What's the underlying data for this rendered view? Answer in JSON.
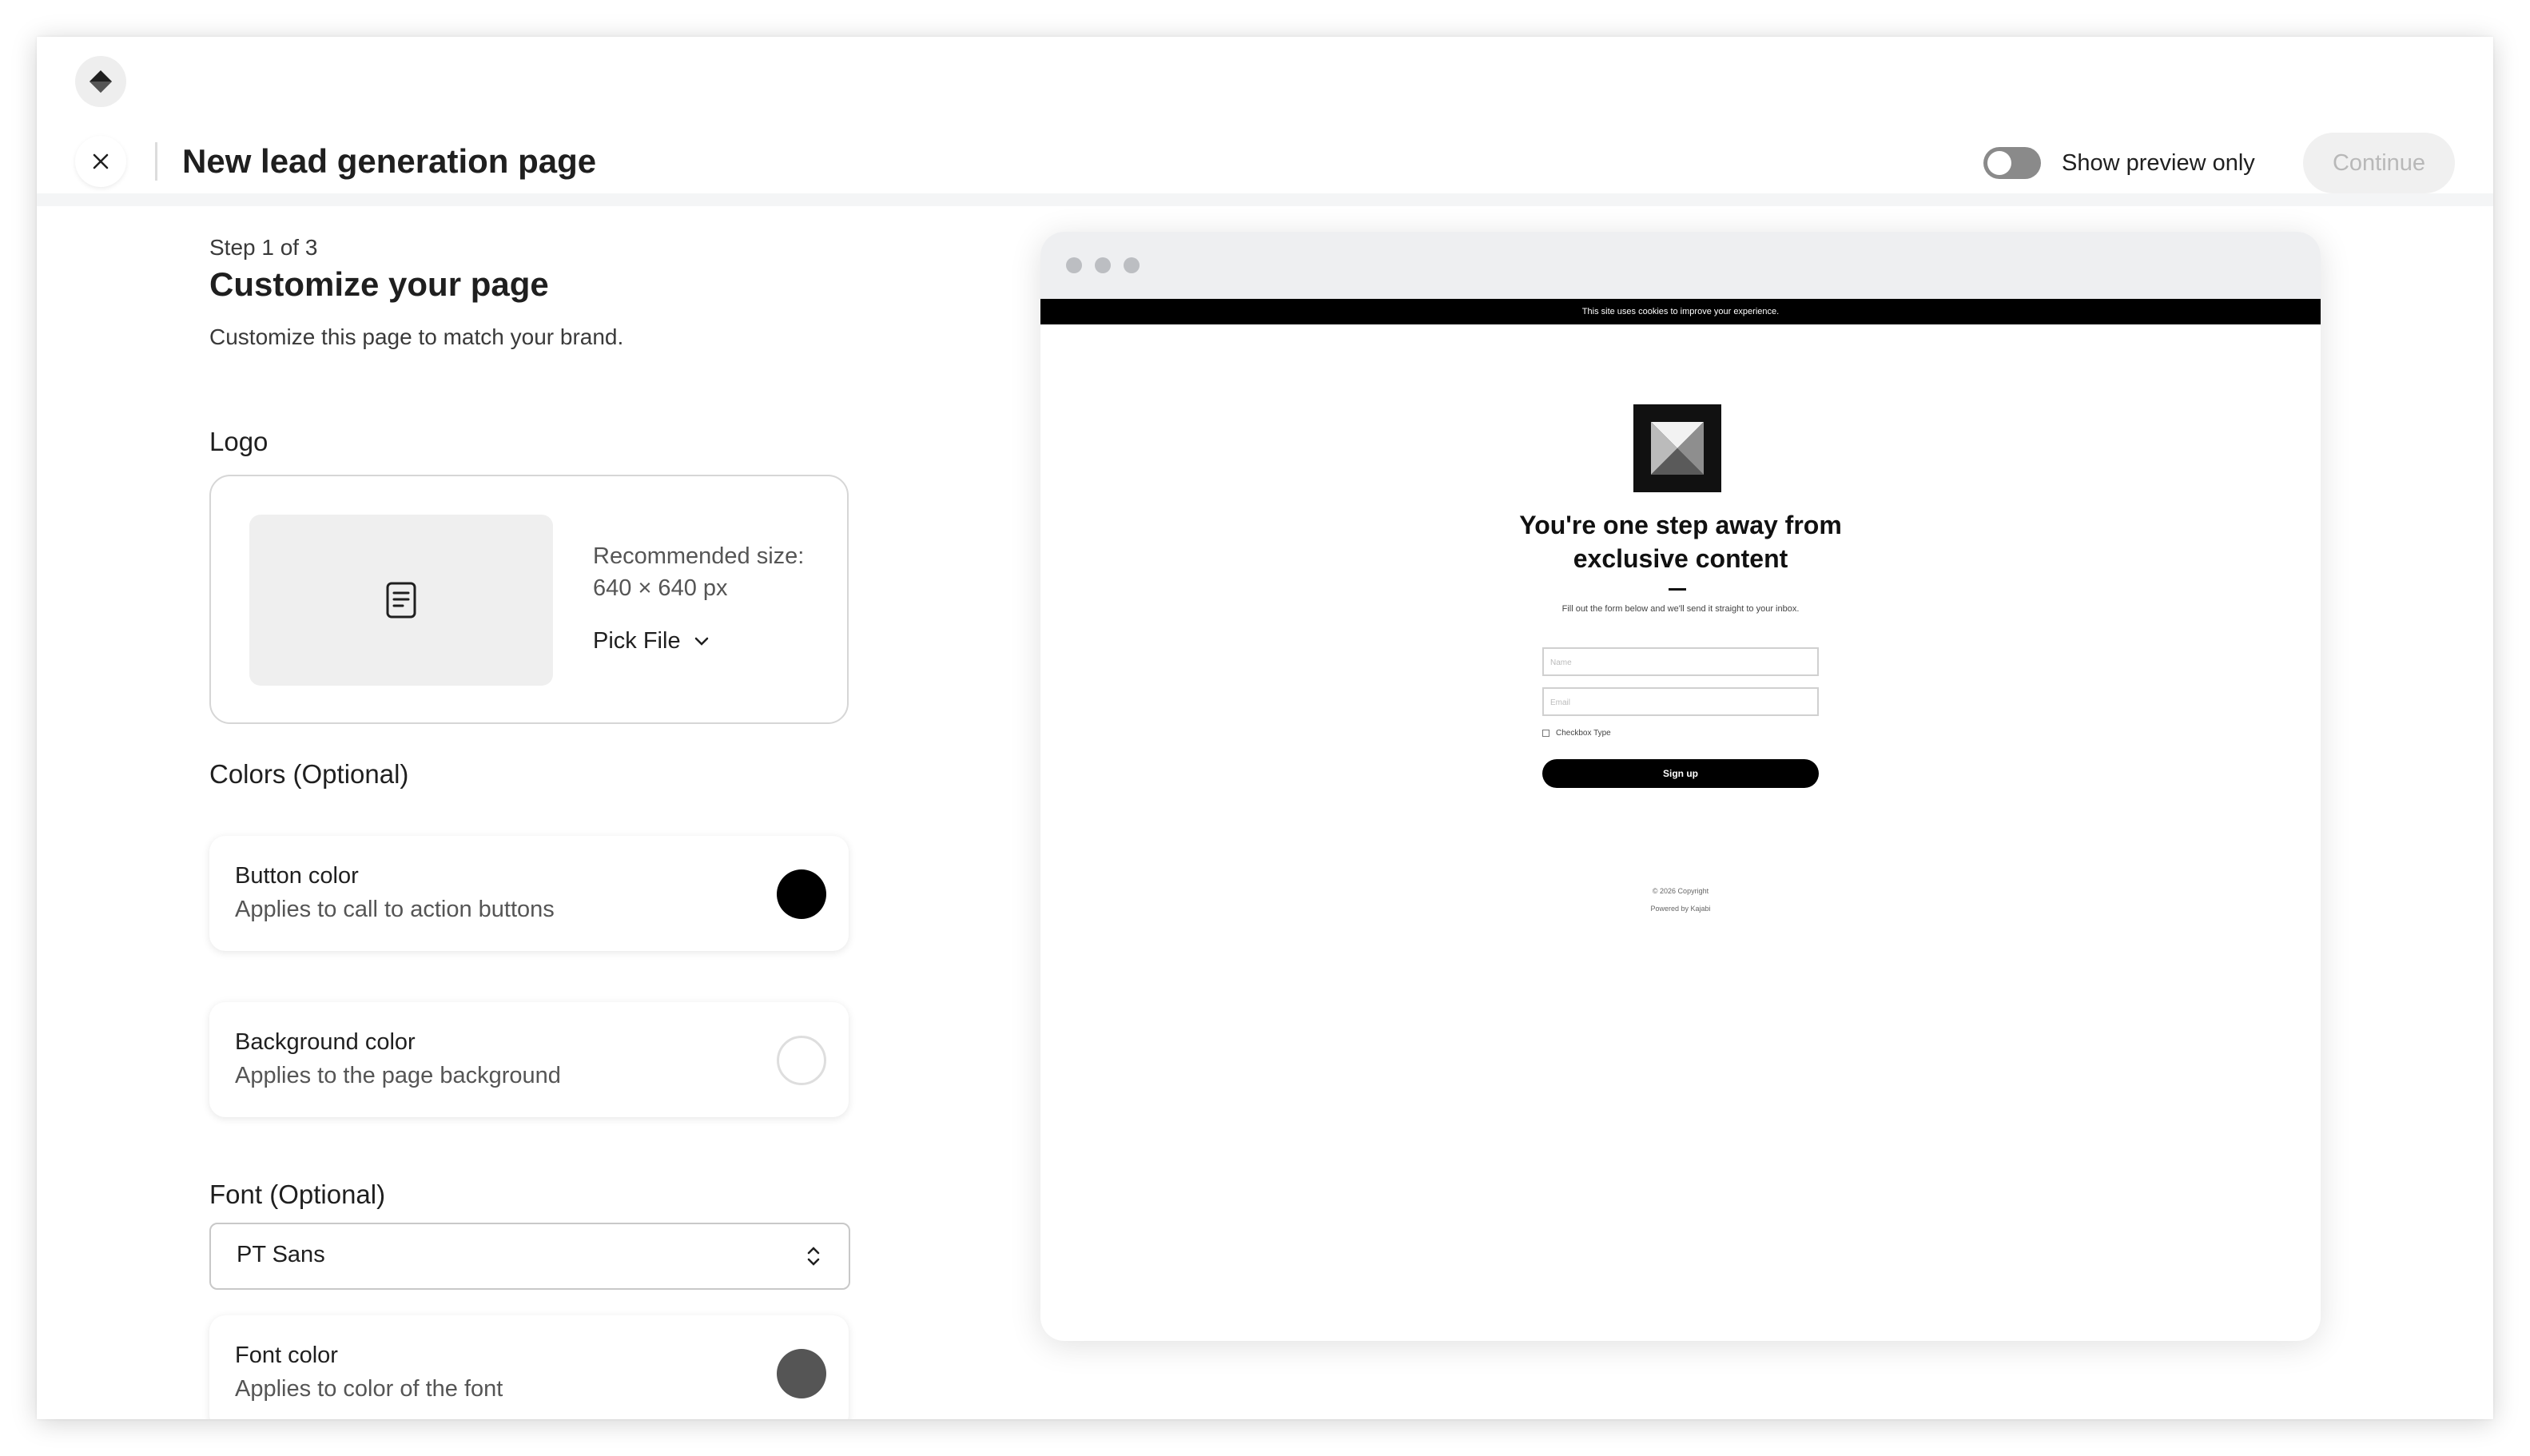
{
  "header": {
    "title": "New lead generation page",
    "toggle_label": "Show preview only",
    "continue_label": "Continue"
  },
  "step": {
    "indicator": "Step 1 of 3",
    "title": "Customize your page",
    "description": "Customize this page to match your brand."
  },
  "logo": {
    "label": "Logo",
    "recommended": "Recommended size: 640 × 640 px",
    "pick_file": "Pick File"
  },
  "colors": {
    "label": "Colors (Optional)",
    "button": {
      "title": "Button color",
      "subtitle": "Applies to call to action buttons",
      "value": "#000000"
    },
    "background": {
      "title": "Background color",
      "subtitle": "Applies to the page background",
      "value": "#ffffff"
    }
  },
  "font": {
    "label": "Font (Optional)",
    "selected": "PT Sans",
    "color": {
      "title": "Font color",
      "subtitle": "Applies to color of the font",
      "value": "#555555"
    }
  },
  "preview": {
    "cookie_text": "This site uses cookies to improve your experience.",
    "headline": "You're one step away from exclusive content",
    "description": "Fill out the form below and we'll send it straight to your inbox.",
    "name_placeholder": "Name",
    "email_placeholder": "Email",
    "checkbox_label": "Checkbox Type",
    "signup_label": "Sign up",
    "copyright": "© 2026 Copyright",
    "powered_by": "Powered by Kajabi"
  }
}
